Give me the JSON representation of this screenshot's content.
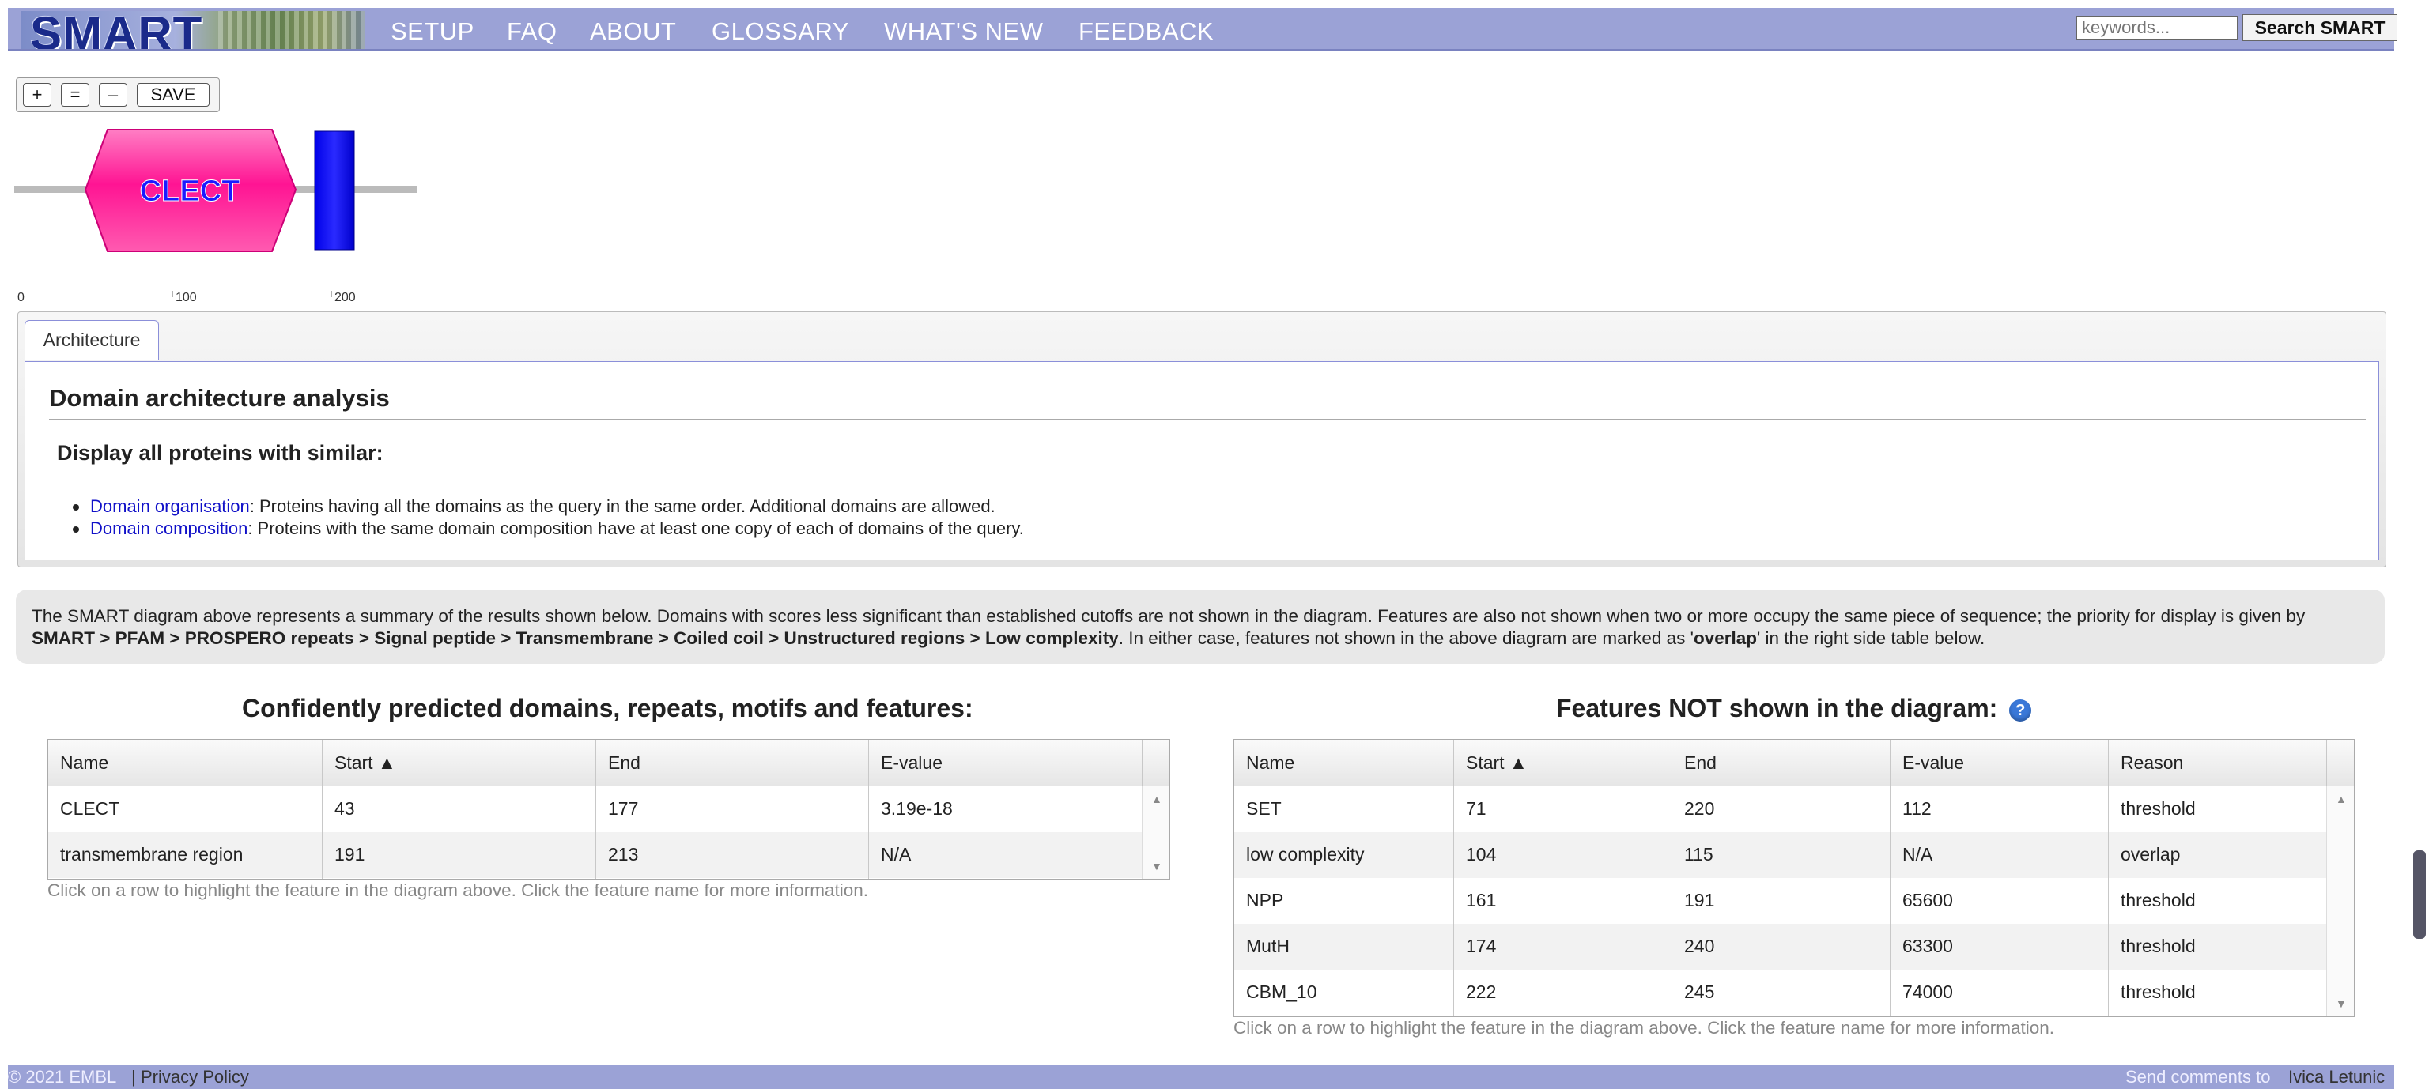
{
  "header": {
    "logo_text": "SMART",
    "nav": [
      "SETUP",
      "FAQ",
      "ABOUT",
      "GLOSSARY",
      "WHAT'S NEW",
      "FEEDBACK"
    ],
    "search_placeholder": "keywords...",
    "search_button": "Search SMART"
  },
  "zoom": {
    "plus": "+",
    "reset": "=",
    "minus": "–",
    "save": "SAVE"
  },
  "diagram": {
    "domain_label": "CLECT",
    "domain_color": "#ff1493",
    "tm_color": "#0000ff",
    "axis_labels": [
      "0",
      "100",
      "200"
    ]
  },
  "tabs": {
    "architecture": "Architecture"
  },
  "architecture": {
    "title": "Domain architecture analysis",
    "subtitle": "Display all proteins with similar:",
    "items": [
      {
        "link": "Domain organisation",
        "text": ": Proteins having all the domains as the query in the same order. Additional domains are allowed."
      },
      {
        "link": "Domain composition",
        "text": ": Proteins with the same domain composition have at least one copy of each of domains of the query."
      }
    ]
  },
  "summary": {
    "text1": "The SMART diagram above represents a summary of the results shown below. Domains with scores less significant than established cutoffs are not shown in the diagram. Features are also not shown when two or more occupy the same piece of sequence; the priority for display is given by ",
    "priority": "SMART > PFAM > PROSPERO repeats > Signal peptide > Transmembrane > Coiled coil > Unstructured regions > Low complexity",
    "text2": ". In either case, features not shown in the above diagram are marked as '",
    "overlap": "overlap",
    "text3": "' in the right side table below."
  },
  "predicted": {
    "title": "Confidently predicted domains, repeats, motifs and features:",
    "columns": [
      "Name",
      "Start ▲",
      "End",
      "E-value"
    ],
    "rows": [
      {
        "name": "CLECT",
        "start": "43",
        "end": "177",
        "evalue": "3.19e-18"
      },
      {
        "name": "transmembrane region",
        "start": "191",
        "end": "213",
        "evalue": "N/A"
      }
    ],
    "hint": "Click on a row to highlight the feature in the diagram above. Click the feature name for more information."
  },
  "not_shown": {
    "title": "Features NOT shown in the diagram:",
    "help_icon": "?",
    "columns": [
      "Name",
      "Start ▲",
      "End",
      "E-value",
      "Reason"
    ],
    "rows": [
      {
        "name": "SET",
        "start": "71",
        "end": "220",
        "evalue": "112",
        "reason": "threshold"
      },
      {
        "name": "low complexity",
        "start": "104",
        "end": "115",
        "evalue": "N/A",
        "reason": "overlap"
      },
      {
        "name": "NPP",
        "start": "161",
        "end": "191",
        "evalue": "65600",
        "reason": "threshold"
      },
      {
        "name": "MutH",
        "start": "174",
        "end": "240",
        "evalue": "63300",
        "reason": "threshold"
      },
      {
        "name": "CBM_10",
        "start": "222",
        "end": "245",
        "evalue": "74000",
        "reason": "threshold"
      }
    ],
    "hint": "Click on a row to highlight the feature in the diagram above. Click the feature name for more information."
  },
  "footer": {
    "copyright": "© 2021 EMBL",
    "separator": "|",
    "privacy": "Privacy Policy",
    "comments": "Send comments to",
    "author": "Ivica Letunic"
  }
}
